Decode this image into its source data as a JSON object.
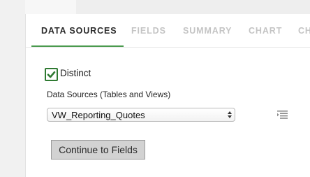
{
  "tabs": [
    {
      "label": "DATA SOURCES",
      "active": true
    },
    {
      "label": "FIELDS",
      "active": false
    },
    {
      "label": "SUMMARY",
      "active": false
    },
    {
      "label": "CHART",
      "active": false
    },
    {
      "label": "CH",
      "active": false
    }
  ],
  "distinct": {
    "label": "Distinct",
    "checked": true
  },
  "data_sources": {
    "label": "Data Sources (Tables and Views)",
    "selected": "VW_Reporting_Quotes"
  },
  "continue_button": {
    "label": "Continue to Fields"
  },
  "icons": {
    "checkbox": "checkmark-icon",
    "select_arrows": "up-down-arrows-icon",
    "list": "list-icon"
  },
  "colors": {
    "accent": "#4a9a4e",
    "checkbox_border": "#2f7a32",
    "button_bg": "#d2d2d2"
  }
}
